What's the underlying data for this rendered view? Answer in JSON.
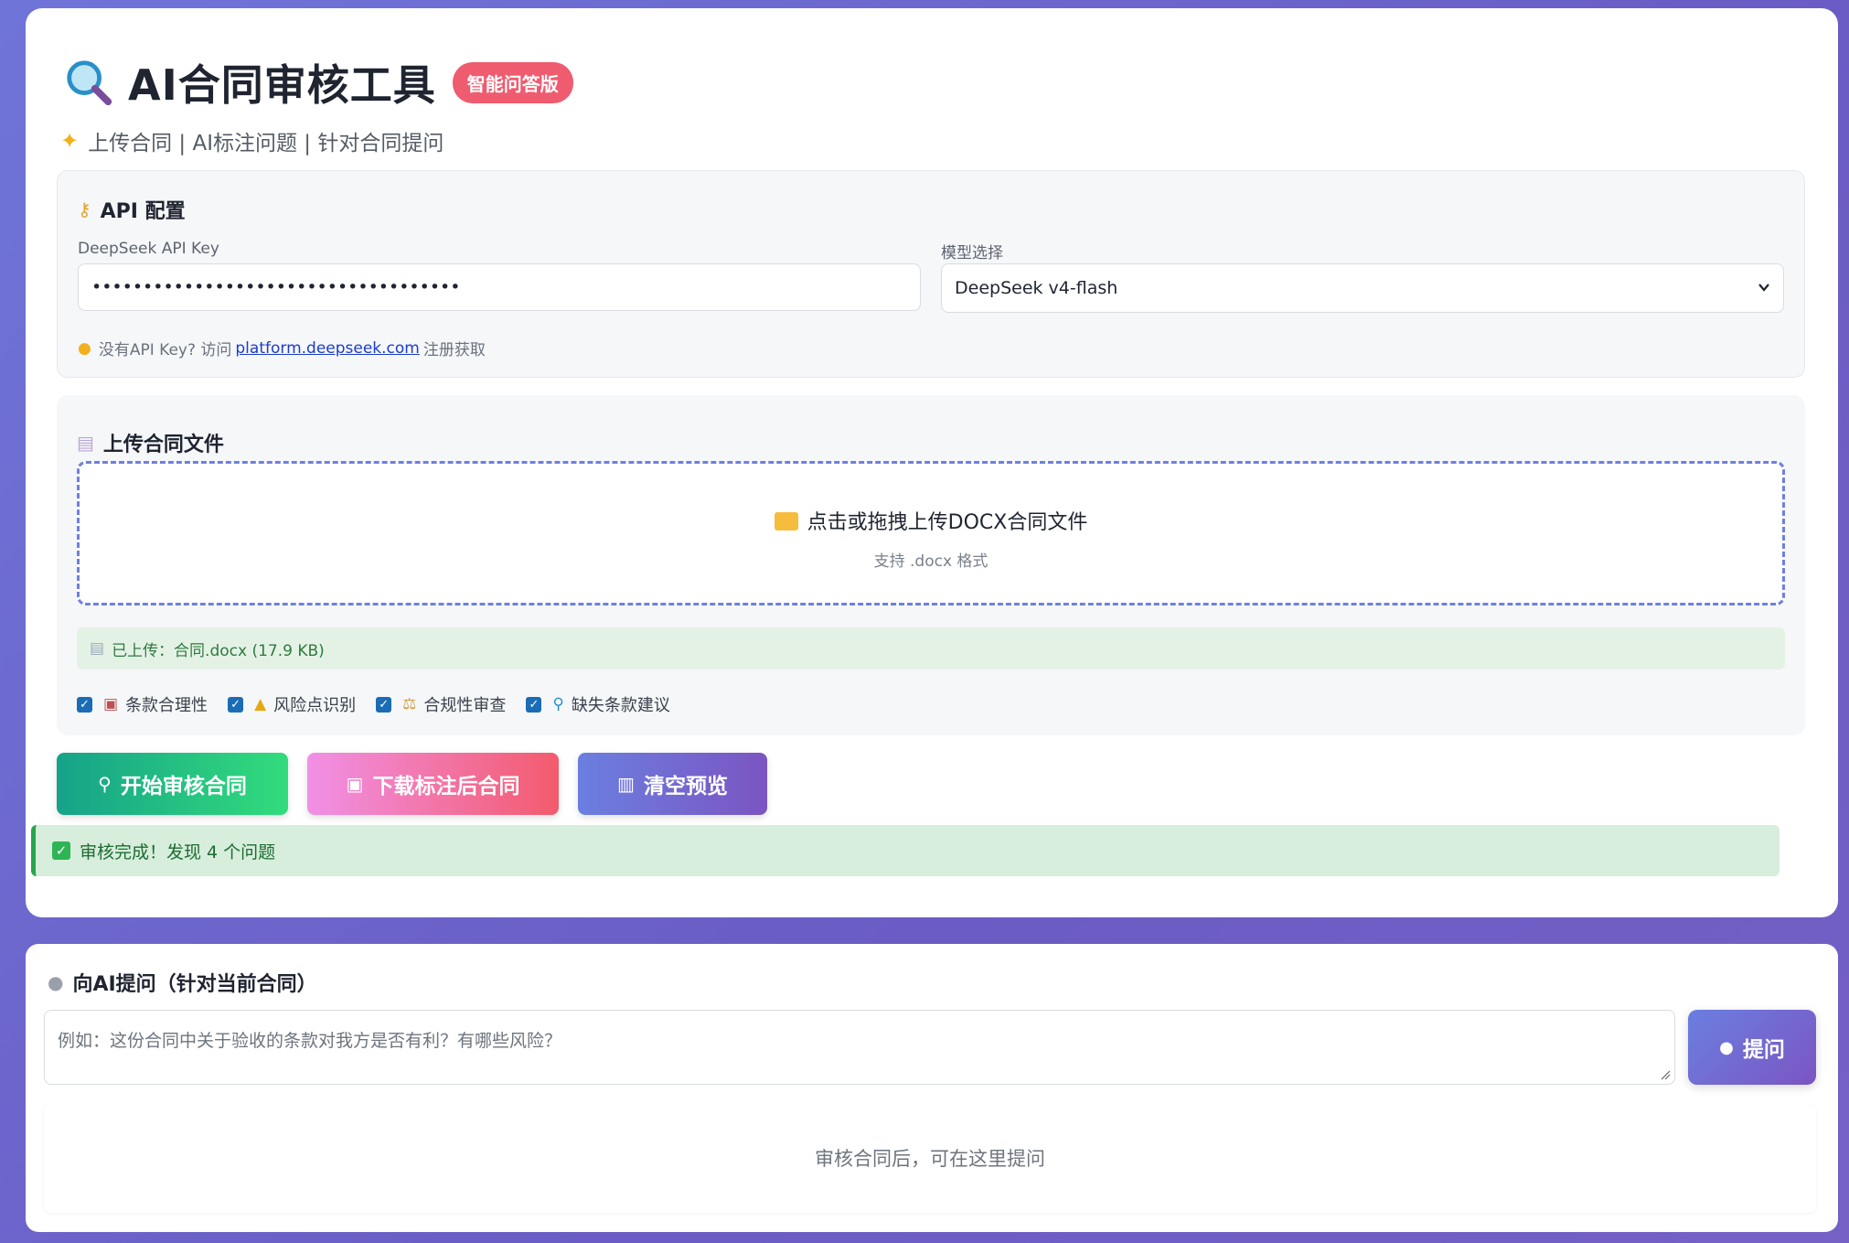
{
  "header": {
    "title": "AI合同审核工具",
    "badge": "智能问答版",
    "subtitle": "上传合同 | AI标注问题 | 针对合同提问"
  },
  "api_config": {
    "title": "API 配置",
    "api_key_label": "DeepSeek API Key",
    "api_key_value": "••••••••••••••••••••••••••••••••••••",
    "model_label": "模型选择",
    "model_selected": "DeepSeek v4-flash",
    "hint_prefix": "没有API Key? 访问",
    "hint_link": "platform.deepseek.com",
    "hint_suffix": "注册获取"
  },
  "upload": {
    "title": "上传合同文件",
    "dropzone_text": "点击或拖拽上传DOCX合同文件",
    "dropzone_sub": "支持 .docx 格式",
    "uploaded_text": "已上传：合同.docx (17.9 KB)",
    "options": [
      {
        "label": "条款合理性",
        "checked": true,
        "icon": "clipboard-icon"
      },
      {
        "label": "风险点识别",
        "checked": true,
        "icon": "warning-icon"
      },
      {
        "label": "合规性审查",
        "checked": true,
        "icon": "scales-icon"
      },
      {
        "label": "缺失条款建议",
        "checked": true,
        "icon": "magnifier-icon"
      }
    ]
  },
  "actions": {
    "start": "开始审核合同",
    "download": "下载标注后合同",
    "clear": "清空预览"
  },
  "status": {
    "text": "审核完成！发现 4 个问题"
  },
  "chat": {
    "title": "向AI提问（针对当前合同）",
    "placeholder": "例如：这份合同中关于验收的条款对我方是否有利？有哪些风险？",
    "ask_button": "提问",
    "empty_answer": "审核合同后，可在这里提问"
  }
}
